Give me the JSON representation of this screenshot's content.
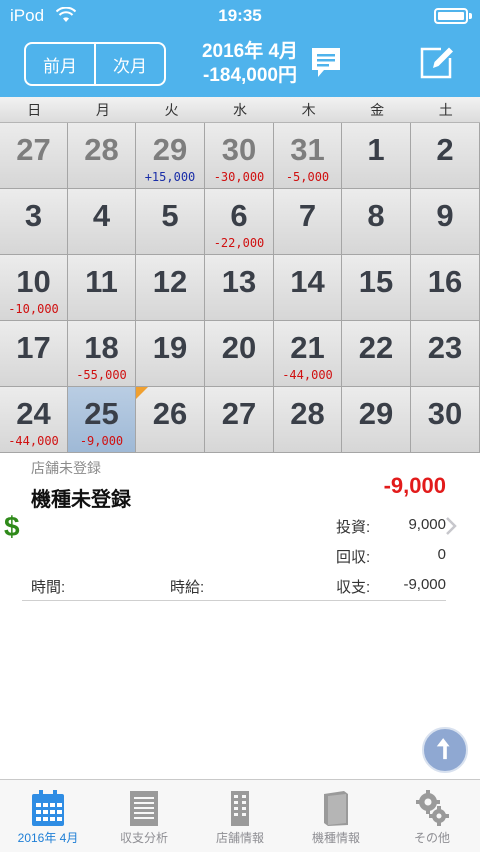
{
  "status": {
    "carrier": "iPod",
    "time": "19:35"
  },
  "nav": {
    "prev_month": "前月",
    "next_month": "次月",
    "title_month": "2016年 4月",
    "title_total": "-184,000円"
  },
  "calendar": {
    "weekdays": [
      "日",
      "月",
      "火",
      "水",
      "木",
      "金",
      "土"
    ],
    "weeks": [
      [
        {
          "day": "27",
          "other": true,
          "amount": ""
        },
        {
          "day": "28",
          "other": true,
          "amount": ""
        },
        {
          "day": "29",
          "other": true,
          "amount": "+15,000",
          "sign": "pos"
        },
        {
          "day": "30",
          "other": true,
          "amount": "-30,000",
          "sign": "neg"
        },
        {
          "day": "31",
          "other": true,
          "amount": "-5,000",
          "sign": "neg"
        },
        {
          "day": "1",
          "amount": ""
        },
        {
          "day": "2",
          "amount": ""
        }
      ],
      [
        {
          "day": "3",
          "amount": ""
        },
        {
          "day": "4",
          "amount": ""
        },
        {
          "day": "5",
          "amount": ""
        },
        {
          "day": "6",
          "amount": "-22,000",
          "sign": "neg"
        },
        {
          "day": "7",
          "amount": ""
        },
        {
          "day": "8",
          "amount": ""
        },
        {
          "day": "9",
          "amount": ""
        }
      ],
      [
        {
          "day": "10",
          "amount": "-10,000",
          "sign": "neg"
        },
        {
          "day": "11",
          "amount": ""
        },
        {
          "day": "12",
          "amount": ""
        },
        {
          "day": "13",
          "amount": ""
        },
        {
          "day": "14",
          "amount": ""
        },
        {
          "day": "15",
          "amount": ""
        },
        {
          "day": "16",
          "amount": ""
        }
      ],
      [
        {
          "day": "17",
          "amount": ""
        },
        {
          "day": "18",
          "amount": "-55,000",
          "sign": "neg"
        },
        {
          "day": "19",
          "amount": ""
        },
        {
          "day": "20",
          "amount": ""
        },
        {
          "day": "21",
          "amount": "-44,000",
          "sign": "neg"
        },
        {
          "day": "22",
          "amount": ""
        },
        {
          "day": "23",
          "amount": ""
        }
      ],
      [
        {
          "day": "24",
          "amount": "-44,000",
          "sign": "neg"
        },
        {
          "day": "25",
          "amount": "-9,000",
          "sign": "neg",
          "selected": true
        },
        {
          "day": "26",
          "amount": "",
          "flag": true
        },
        {
          "day": "27",
          "amount": ""
        },
        {
          "day": "28",
          "amount": ""
        },
        {
          "day": "29",
          "amount": ""
        },
        {
          "day": "30",
          "amount": ""
        }
      ]
    ]
  },
  "detail": {
    "shop": "店舗未登録",
    "machine": "機種未登録",
    "total": "-9,000",
    "investment_label": "投資:",
    "investment_value": "9,000",
    "recovery_label": "回収:",
    "recovery_value": "0",
    "balance_label": "収支:",
    "balance_value": "-9,000",
    "time_label": "時間:",
    "hourly_label": "時給:"
  },
  "tabs": [
    {
      "label": "2016年 4月",
      "icon": "calendar-icon",
      "active": true
    },
    {
      "label": "収支分析",
      "icon": "notebook-icon"
    },
    {
      "label": "店舗情報",
      "icon": "building-icon"
    },
    {
      "label": "機種情報",
      "icon": "book-icon"
    },
    {
      "label": "その他",
      "icon": "gears-icon"
    }
  ],
  "colors": {
    "nav_bg": "#4fb3ec",
    "negative": "#d01010",
    "positive": "#1a2ea8",
    "total_red": "#e21b1b",
    "tab_active": "#1f7fd6"
  }
}
